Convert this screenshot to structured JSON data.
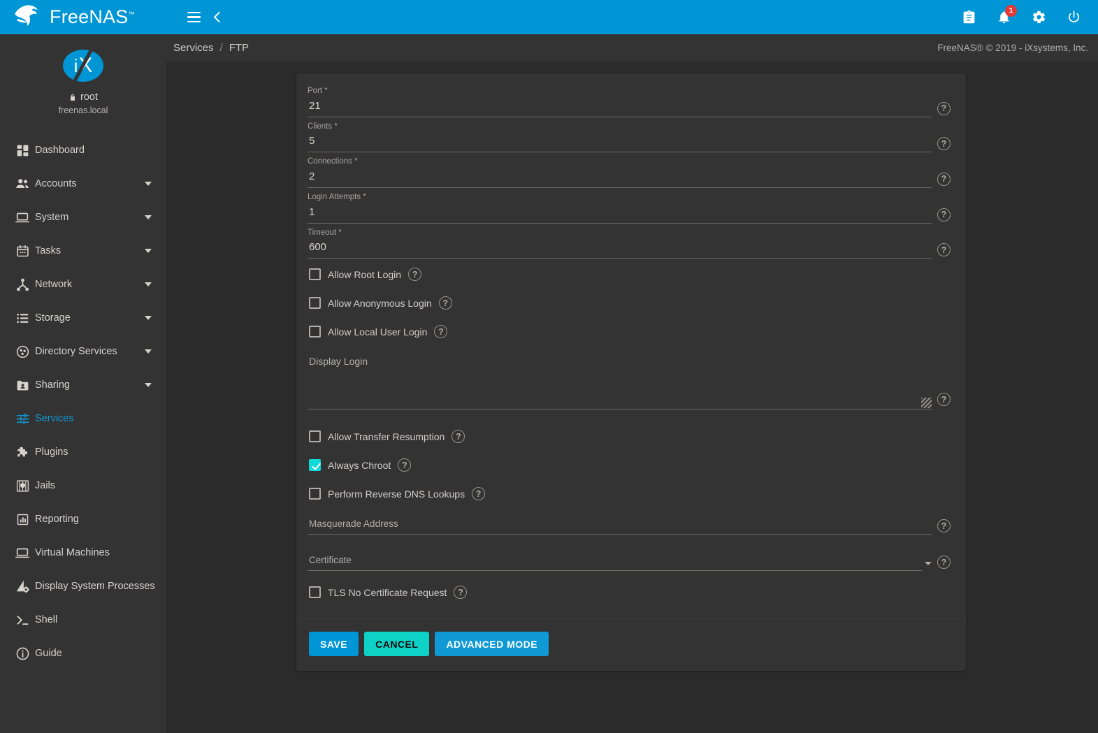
{
  "brand": {
    "name": "FreeNAS",
    "tm": "™",
    "logo_icon": "freenas-fish-logo"
  },
  "topbar": {
    "menu_icon": "hamburger-menu-icon",
    "back_icon": "chevron-left-icon",
    "icons": [
      {
        "name": "clipboard-icon",
        "glyph": "clipboard"
      },
      {
        "name": "notifications-bell-icon",
        "glyph": "bell",
        "badge": "1"
      },
      {
        "name": "settings-gear-icon",
        "glyph": "gear"
      },
      {
        "name": "power-icon",
        "glyph": "power"
      }
    ],
    "badge_color": "#e53935",
    "bg_color": "#0095d5"
  },
  "sidebar": {
    "avatar_text_i": "i",
    "avatar_text_x": "X",
    "lock_icon": "lock-icon",
    "username": "root",
    "hostname": "freenas.local",
    "items": [
      {
        "label": "Dashboard",
        "icon": "dashboard-icon",
        "expandable": false,
        "active": false
      },
      {
        "label": "Accounts",
        "icon": "accounts-people-icon",
        "expandable": true,
        "active": false
      },
      {
        "label": "System",
        "icon": "system-laptop-icon",
        "expandable": true,
        "active": false
      },
      {
        "label": "Tasks",
        "icon": "tasks-calendar-icon",
        "expandable": true,
        "active": false
      },
      {
        "label": "Network",
        "icon": "network-icon",
        "expandable": true,
        "active": false
      },
      {
        "label": "Storage",
        "icon": "storage-list-icon",
        "expandable": true,
        "active": false
      },
      {
        "label": "Directory Services",
        "icon": "directory-services-icon",
        "expandable": true,
        "active": false
      },
      {
        "label": "Sharing",
        "icon": "sharing-folder-icon",
        "expandable": true,
        "active": false
      },
      {
        "label": "Services",
        "icon": "services-sliders-icon",
        "expandable": false,
        "active": true
      },
      {
        "label": "Plugins",
        "icon": "plugins-puzzle-icon",
        "expandable": false,
        "active": false
      },
      {
        "label": "Jails",
        "icon": "jails-icon",
        "expandable": false,
        "active": false
      },
      {
        "label": "Reporting",
        "icon": "reporting-chart-icon",
        "expandable": false,
        "active": false
      },
      {
        "label": "Virtual Machines",
        "icon": "virtual-machines-icon",
        "expandable": false,
        "active": false
      },
      {
        "label": "Display System Processes",
        "icon": "system-processes-icon",
        "expandable": false,
        "active": false
      },
      {
        "label": "Shell",
        "icon": "shell-prompt-icon",
        "expandable": false,
        "active": false
      },
      {
        "label": "Guide",
        "icon": "guide-info-icon",
        "expandable": false,
        "active": false
      }
    ],
    "active_color": "#0f9ad6"
  },
  "breadcrumb": {
    "parent": "Services",
    "separator": "/",
    "current": "FTP"
  },
  "copyright": "FreeNAS® © 2019 - iXsystems, Inc.",
  "form": {
    "text_fields": [
      {
        "label": "Port *",
        "value": "21",
        "name": "port-field"
      },
      {
        "label": "Clients *",
        "value": "5",
        "name": "clients-field"
      },
      {
        "label": "Connections *",
        "value": "2",
        "name": "connections-field"
      },
      {
        "label": "Login Attempts *",
        "value": "1",
        "name": "login-attempts-field"
      },
      {
        "label": "Timeout *",
        "value": "600",
        "name": "timeout-field"
      }
    ],
    "login_checkboxes": [
      {
        "label": "Allow Root Login",
        "checked": false,
        "name": "allow-root-login-checkbox"
      },
      {
        "label": "Allow Anonymous Login",
        "checked": false,
        "name": "allow-anonymous-login-checkbox"
      },
      {
        "label": "Allow Local User Login",
        "checked": false,
        "name": "allow-local-user-login-checkbox"
      }
    ],
    "display_login": {
      "label": "Display Login",
      "value": ""
    },
    "transfer_checkboxes": [
      {
        "label": "Allow Transfer Resumption",
        "checked": false,
        "name": "allow-transfer-resumption-checkbox"
      },
      {
        "label": "Always Chroot",
        "checked": true,
        "name": "always-chroot-checkbox"
      },
      {
        "label": "Perform Reverse DNS Lookups",
        "checked": false,
        "name": "perform-reverse-dns-lookups-checkbox"
      }
    ],
    "masquerade_address": {
      "label": "Masquerade Address",
      "value": ""
    },
    "certificate": {
      "label": "Certificate",
      "value": ""
    },
    "tls_checkbox": {
      "label": "TLS No Certificate Request",
      "checked": false
    },
    "help_icon": "help-circle-icon",
    "checked_color": "#0fd9d9"
  },
  "actions": {
    "save": "SAVE",
    "cancel": "CANCEL",
    "advanced": "ADVANCED MODE",
    "primary_color": "#0095d5",
    "accent_color": "#0fd2c6"
  }
}
